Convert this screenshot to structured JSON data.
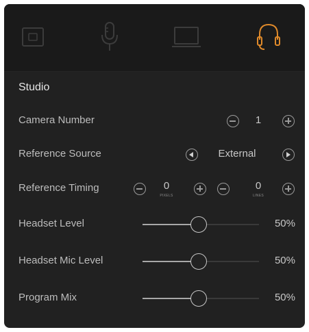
{
  "tabs": [
    {
      "icon": "camera-icon",
      "active": false
    },
    {
      "icon": "microphone-icon",
      "active": false
    },
    {
      "icon": "display-icon",
      "active": false
    },
    {
      "icon": "headset-icon",
      "active": true
    }
  ],
  "accent_color": "#e08a2a",
  "section_title": "Studio",
  "camera_number": {
    "label": "Camera Number",
    "value": "1"
  },
  "reference_source": {
    "label": "Reference Source",
    "value": "External"
  },
  "reference_timing": {
    "label": "Reference Timing",
    "pixels": {
      "value": "0",
      "unit": "PIXELS"
    },
    "lines": {
      "value": "0",
      "unit": "LINES"
    }
  },
  "headset_level": {
    "label": "Headset Level",
    "value": "50%",
    "level": 0.5
  },
  "headset_mic_level": {
    "label": "Headset Mic Level",
    "value": "50%",
    "level": 0.5
  },
  "program_mix": {
    "label": "Program Mix",
    "value": "50%",
    "level": 0.5
  }
}
